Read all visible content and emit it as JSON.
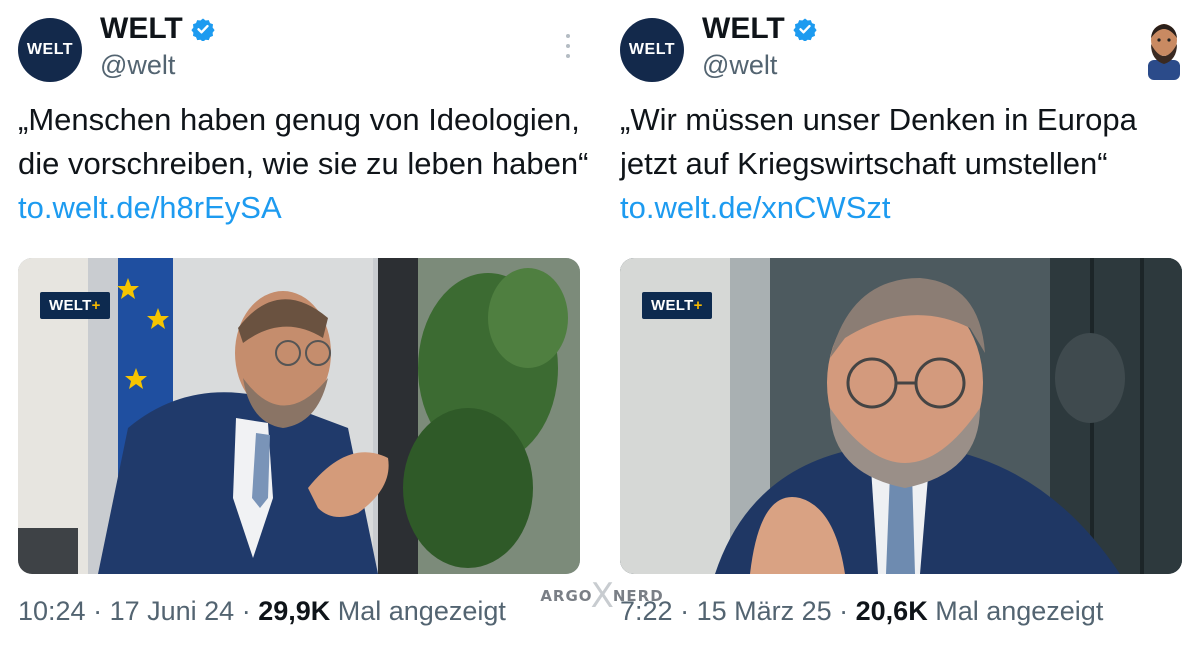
{
  "colors": {
    "verified": "#1d9bf0",
    "link": "#1d9bf0",
    "brand_navy": "#13294b",
    "welt_plus_accent": "#f5b800"
  },
  "tweets": [
    {
      "avatar_text": "WELT",
      "name": "WELT",
      "handle": "@welt",
      "text": "„Menschen haben genug von Ideologien, die vorschreiben, wie sie zu leben haben“ ",
      "link": "to.welt.de/h8rEySA",
      "media_badge": "WELT",
      "media_badge_plus": "+",
      "time": "10:24",
      "date": "17 Juni 24",
      "views_count": "29,9K",
      "views_label": "Mal angezeigt",
      "icons": [
        "verified-icon",
        "more-icon"
      ]
    },
    {
      "avatar_text": "WELT",
      "name": "WELT",
      "handle": "@welt",
      "text": "„Wir müssen unser Denken in Europa jetzt auf Kriegswirtschaft umstellen“ ",
      "link": "to.welt.de/xnCWSzt",
      "media_badge": "WELT",
      "media_badge_plus": "+",
      "time": "7:22",
      "date": "15 März 25",
      "views_count": "20,6K",
      "views_label": "Mal angezeigt",
      "icons": [
        "verified-icon",
        "user-avatar"
      ]
    }
  ],
  "watermark": {
    "left": "ARGO",
    "mid": "X",
    "right": "NERD"
  }
}
